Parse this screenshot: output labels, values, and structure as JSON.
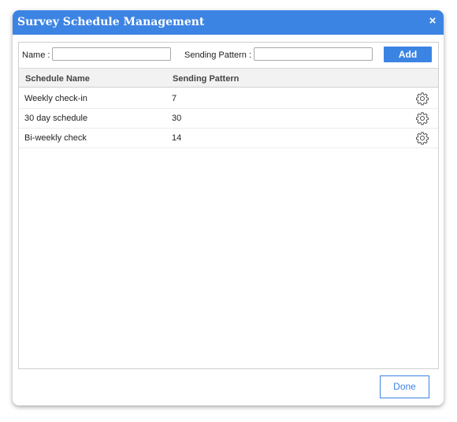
{
  "dialog": {
    "title": "Survey Schedule Management",
    "close_symbol": "×",
    "accent_color": "#3c84e3"
  },
  "form": {
    "name_label": "Name :",
    "name_value": "",
    "pattern_label": "Sending Pattern :",
    "pattern_value": "",
    "add_label": "Add"
  },
  "table": {
    "columns": [
      "Schedule Name",
      "Sending Pattern"
    ],
    "rows": [
      {
        "name": "Weekly check-in",
        "pattern": "7",
        "action_icon": "gear-icon"
      },
      {
        "name": "30 day schedule",
        "pattern": "30",
        "action_icon": "gear-icon"
      },
      {
        "name": "Bi-weekly check",
        "pattern": "14",
        "action_icon": "gear-icon"
      }
    ]
  },
  "footer": {
    "done_label": "Done"
  }
}
